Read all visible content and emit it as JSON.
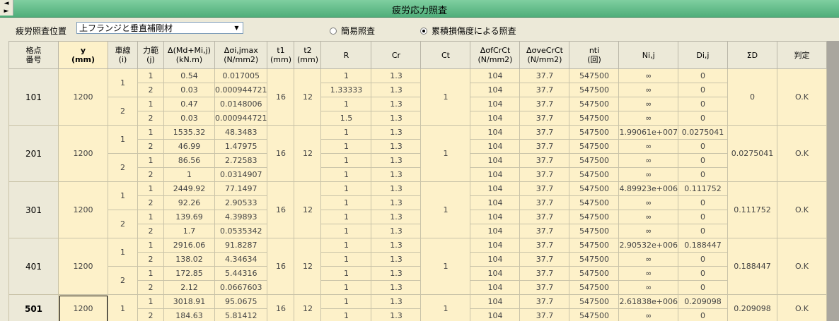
{
  "window": {
    "title": "疲労応力照査"
  },
  "toolbar": {
    "position_label": "疲労照査位置",
    "position_value": "上フランジと垂直補剛材",
    "radio_simple": "簡易照査",
    "radio_cumulative": "累積損傷度による照査",
    "selected_mode": "累積損傷度による照査"
  },
  "columns": [
    "格点\n番号",
    "y\n(mm)",
    "車線\n(i)",
    "力範\n(j)",
    "Δ(Md+Mi,j)\n(kN.m)",
    "Δσi,jmax\n(N/mm2)",
    "t1\n(mm)",
    "t2\n(mm)",
    "R",
    "Cr",
    "Ct",
    "ΔσfCrCt\n(N/mm2)",
    "ΔσveCrCt\n(N/mm2)",
    "nti\n(回)",
    "Ni,j",
    "Di,j",
    "ΣD",
    "判定"
  ],
  "nodes": [
    {
      "id": "101",
      "y": "1200",
      "t1": "16",
      "t2": "12",
      "ct": "1",
      "sumD": "0",
      "judge": "O.K",
      "lanes": [
        {
          "lane": "1",
          "rows": [
            {
              "j": "1",
              "dm": "0.54",
              "ds": "0.017005",
              "r": "1",
              "cr": "1.3",
              "f": "104",
              "ve": "37.7",
              "n": "547500",
              "N": "∞",
              "D": "0"
            },
            {
              "j": "2",
              "dm": "0.03",
              "ds": "0.000944721",
              "r": "1.33333",
              "cr": "1.3",
              "f": "104",
              "ve": "37.7",
              "n": "547500",
              "N": "∞",
              "D": "0"
            }
          ]
        },
        {
          "lane": "2",
          "rows": [
            {
              "j": "1",
              "dm": "0.47",
              "ds": "0.0148006",
              "r": "1",
              "cr": "1.3",
              "f": "104",
              "ve": "37.7",
              "n": "547500",
              "N": "∞",
              "D": "0"
            },
            {
              "j": "2",
              "dm": "0.03",
              "ds": "0.000944721",
              "r": "1.5",
              "cr": "1.3",
              "f": "104",
              "ve": "37.7",
              "n": "547500",
              "N": "∞",
              "D": "0"
            }
          ]
        }
      ]
    },
    {
      "id": "201",
      "y": "1200",
      "t1": "16",
      "t2": "12",
      "ct": "1",
      "sumD": "0.0275041",
      "judge": "O.K",
      "lanes": [
        {
          "lane": "1",
          "rows": [
            {
              "j": "1",
              "dm": "1535.32",
              "ds": "48.3483",
              "r": "1",
              "cr": "1.3",
              "f": "104",
              "ve": "37.7",
              "n": "547500",
              "N": "1.99061e+007",
              "D": "0.0275041"
            },
            {
              "j": "2",
              "dm": "46.99",
              "ds": "1.47975",
              "r": "1",
              "cr": "1.3",
              "f": "104",
              "ve": "37.7",
              "n": "547500",
              "N": "∞",
              "D": "0"
            }
          ]
        },
        {
          "lane": "2",
          "rows": [
            {
              "j": "1",
              "dm": "86.56",
              "ds": "2.72583",
              "r": "1",
              "cr": "1.3",
              "f": "104",
              "ve": "37.7",
              "n": "547500",
              "N": "∞",
              "D": "0"
            },
            {
              "j": "2",
              "dm": "1",
              "ds": "0.0314907",
              "r": "1",
              "cr": "1.3",
              "f": "104",
              "ve": "37.7",
              "n": "547500",
              "N": "∞",
              "D": "0"
            }
          ]
        }
      ]
    },
    {
      "id": "301",
      "y": "1200",
      "t1": "16",
      "t2": "12",
      "ct": "1",
      "sumD": "0.111752",
      "judge": "O.K",
      "lanes": [
        {
          "lane": "1",
          "rows": [
            {
              "j": "1",
              "dm": "2449.92",
              "ds": "77.1497",
              "r": "1",
              "cr": "1.3",
              "f": "104",
              "ve": "37.7",
              "n": "547500",
              "N": "4.89923e+006",
              "D": "0.111752"
            },
            {
              "j": "2",
              "dm": "92.26",
              "ds": "2.90533",
              "r": "1",
              "cr": "1.3",
              "f": "104",
              "ve": "37.7",
              "n": "547500",
              "N": "∞",
              "D": "0"
            }
          ]
        },
        {
          "lane": "2",
          "rows": [
            {
              "j": "1",
              "dm": "139.69",
              "ds": "4.39893",
              "r": "1",
              "cr": "1.3",
              "f": "104",
              "ve": "37.7",
              "n": "547500",
              "N": "∞",
              "D": "0"
            },
            {
              "j": "2",
              "dm": "1.7",
              "ds": "0.0535342",
              "r": "1",
              "cr": "1.3",
              "f": "104",
              "ve": "37.7",
              "n": "547500",
              "N": "∞",
              "D": "0"
            }
          ]
        }
      ]
    },
    {
      "id": "401",
      "y": "1200",
      "t1": "16",
      "t2": "12",
      "ct": "1",
      "sumD": "0.188447",
      "judge": "O.K",
      "lanes": [
        {
          "lane": "1",
          "rows": [
            {
              "j": "1",
              "dm": "2916.06",
              "ds": "91.8287",
              "r": "1",
              "cr": "1.3",
              "f": "104",
              "ve": "37.7",
              "n": "547500",
              "N": "2.90532e+006",
              "D": "0.188447"
            },
            {
              "j": "2",
              "dm": "138.02",
              "ds": "4.34634",
              "r": "1",
              "cr": "1.3",
              "f": "104",
              "ve": "37.7",
              "n": "547500",
              "N": "∞",
              "D": "0"
            }
          ]
        },
        {
          "lane": "2",
          "rows": [
            {
              "j": "1",
              "dm": "172.85",
              "ds": "5.44316",
              "r": "1",
              "cr": "1.3",
              "f": "104",
              "ve": "37.7",
              "n": "547500",
              "N": "∞",
              "D": "0"
            },
            {
              "j": "2",
              "dm": "2.12",
              "ds": "0.0667603",
              "r": "1",
              "cr": "1.3",
              "f": "104",
              "ve": "37.7",
              "n": "547500",
              "N": "∞",
              "D": "0"
            }
          ]
        }
      ]
    },
    {
      "id": "501",
      "y": "1200",
      "t1": "16",
      "t2": "12",
      "ct": "1",
      "sumD": "0.209098",
      "judge": "O.K",
      "lanes": [
        {
          "lane": "1",
          "rows": [
            {
              "j": "1",
              "dm": "3018.91",
              "ds": "95.0675",
              "r": "1",
              "cr": "1.3",
              "f": "104",
              "ve": "37.7",
              "n": "547500",
              "N": "2.61838e+006",
              "D": "0.209098"
            },
            {
              "j": "2",
              "dm": "184.63",
              "ds": "5.81412",
              "r": "1",
              "cr": "1.3",
              "f": "104",
              "ve": "37.7",
              "n": "547500",
              "N": "∞",
              "D": "0"
            }
          ]
        }
      ]
    }
  ]
}
